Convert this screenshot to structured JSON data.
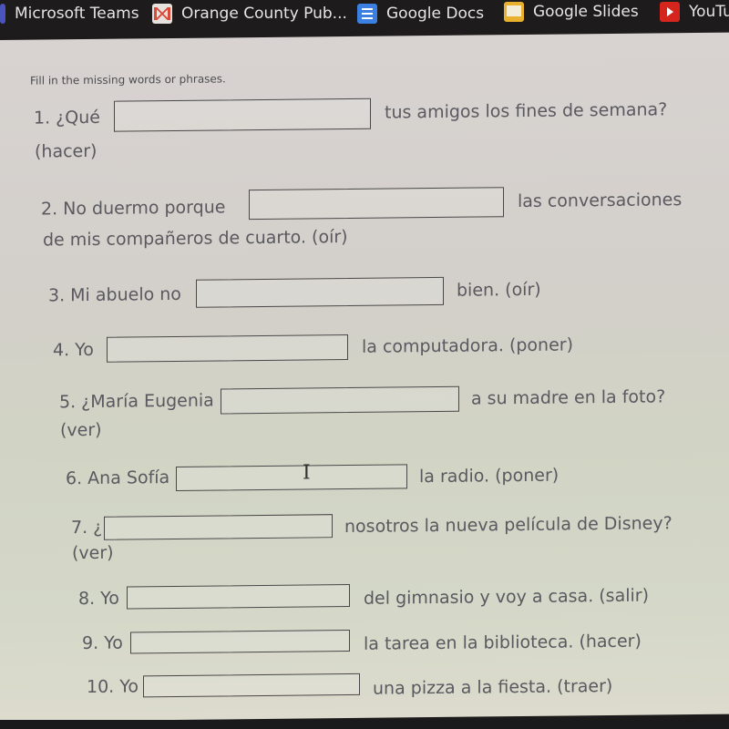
{
  "bookmarks_bar": {
    "items": [
      {
        "label": "Microsoft Teams",
        "icon": "teams-icon"
      },
      {
        "label": "Orange County Pub...",
        "icon": "gmail-icon"
      },
      {
        "label": "Google Docs",
        "icon": "google-docs-icon"
      },
      {
        "label": "Google Slides",
        "icon": "google-slides-icon"
      },
      {
        "label": "YouTu",
        "icon": "youtube-icon"
      }
    ]
  },
  "worksheet": {
    "instructions": "Fill in the missing words or phrases.",
    "questions": [
      {
        "number_label": "1. ¿Qué",
        "answer": "",
        "after": "tus amigos los fines de semana?",
        "hint": "(hacer)"
      },
      {
        "number_label": "2. No duermo porque",
        "answer": "",
        "after": "las conversaciones",
        "hint": "de mis compañeros de cuarto. (oír)"
      },
      {
        "number_label": "3. Mi abuelo no",
        "answer": "",
        "after": "bien. (oír)",
        "hint": ""
      },
      {
        "number_label": "4. Yo",
        "answer": "",
        "after": "la computadora. (poner)",
        "hint": ""
      },
      {
        "number_label": "5. ¿María Eugenia",
        "answer": "",
        "after": "a su madre en la foto?",
        "hint": "(ver)"
      },
      {
        "number_label": "6. Ana Sofía",
        "answer": "",
        "after": "la radio. (poner)",
        "hint": ""
      },
      {
        "number_label": "7. ¿",
        "answer": "",
        "after": "nosotros la nueva película de Disney?",
        "hint": "(ver)"
      },
      {
        "number_label": "8. Yo",
        "answer": "",
        "after": "del gimnasio y voy a casa. (salir)",
        "hint": ""
      },
      {
        "number_label": "9. Yo",
        "answer": "",
        "after": "la tarea en la biblioteca. (hacer)",
        "hint": ""
      },
      {
        "number_label": "10. Yo",
        "answer": "",
        "after": "una pizza a la fiesta. (traer)",
        "hint": ""
      }
    ]
  }
}
